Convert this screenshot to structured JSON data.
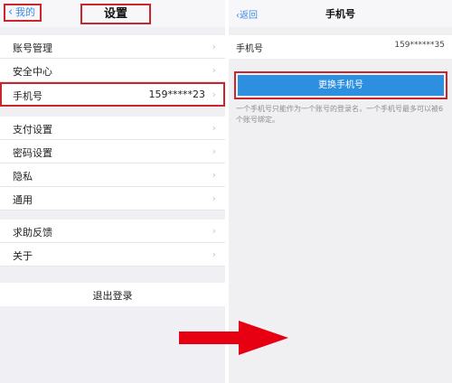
{
  "left": {
    "back_label": "我的",
    "title": "设置",
    "groups": [
      [
        {
          "label": "账号管理",
          "value": ""
        },
        {
          "label": "安全中心",
          "value": ""
        },
        {
          "label": "手机号",
          "value": "159*****23"
        }
      ],
      [
        {
          "label": "支付设置",
          "value": ""
        },
        {
          "label": "密码设置",
          "value": ""
        },
        {
          "label": "隐私",
          "value": ""
        },
        {
          "label": "通用",
          "value": ""
        }
      ],
      [
        {
          "label": "求助反馈",
          "value": ""
        },
        {
          "label": "关于",
          "value": ""
        }
      ]
    ],
    "logout_label": "退出登录"
  },
  "right": {
    "back_label": "返回",
    "title": "手机号",
    "phone_label": "手机号",
    "phone_value": "159******35",
    "change_button": "更换手机号",
    "hint": "一个手机号只能作为一个账号的登录名，一个手机号最多可以被6个账号绑定。"
  },
  "colors": {
    "accent_blue": "#2c8fe0",
    "highlight_red": "#c8252c",
    "arrow_red": "#e60012"
  },
  "icons": {
    "chevron": "chevron-right-icon",
    "back": "chevron-left-icon"
  }
}
